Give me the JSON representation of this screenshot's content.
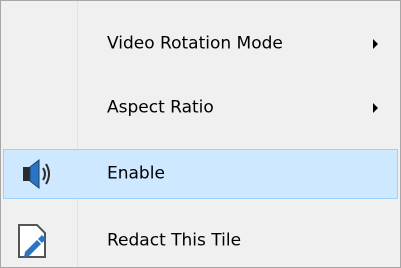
{
  "menu": {
    "items": [
      {
        "label": "Video Rotation Mode",
        "has_submenu": true,
        "icon": null,
        "highlighted": false
      },
      {
        "label": "Aspect Ratio",
        "has_submenu": true,
        "icon": null,
        "highlighted": false
      },
      {
        "label": "Enable",
        "has_submenu": false,
        "icon": "speaker-icon",
        "highlighted": true
      },
      {
        "label": "Redact This Tile",
        "has_submenu": false,
        "icon": "redact-pen-icon",
        "highlighted": false
      }
    ]
  },
  "colors": {
    "menu_background": "#f0f0f0",
    "highlight_background": "#cde8ff",
    "highlight_border": "#99d1ff",
    "border": "#a7a7a7",
    "icon_blue": "#2a74c5"
  }
}
